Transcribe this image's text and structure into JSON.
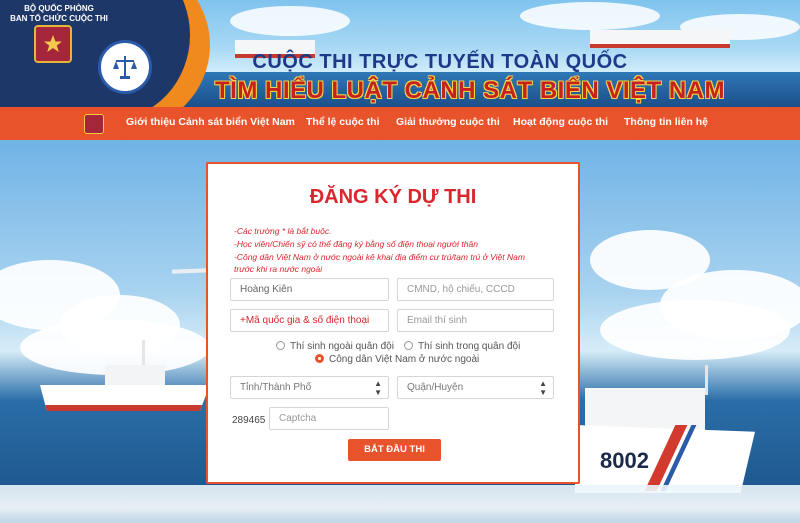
{
  "header": {
    "org_line1": "BỘ QUỐC PHÒNG",
    "org_line2": "BAN TỔ CHỨC CUỘC THI",
    "title_line1": "CUỘC THI TRỰC TUYẾN TOÀN QUỐC",
    "title_line2": "TÌM HIỂU LUẬT CẢNH SÁT BIỂN VIỆT NAM"
  },
  "nav": {
    "items": [
      {
        "label": "Giới thiệu Cảnh sát biển Việt Nam"
      },
      {
        "label": "Thể lệ cuộc thi"
      },
      {
        "label": "Giải thưởng cuộc thi"
      },
      {
        "label": "Hoạt động cuộc thi"
      },
      {
        "label": "Thông tin liên hệ"
      }
    ]
  },
  "form": {
    "title": "ĐĂNG KÝ DỰ THI",
    "notes": [
      "-Các trường * là bắt buộc.",
      "-Học viên/Chiến sỹ có thể đăng ký bằng số điện thoại người thân",
      "-Công dân Việt Nam ở nước ngoài kê khai địa điểm cư trú/tạm trú ở Việt Nam",
      "trước khi ra nước ngoài"
    ],
    "name_value": "Hoàng Kiên",
    "id_placeholder": "CMND, hộ chiếu, CCCD",
    "phone_placeholder": "+Mã quốc gia & số điện thoại",
    "email_placeholder": "Email thí sinh",
    "radios": [
      {
        "label": "Thí sinh ngoài quân đội",
        "checked": false
      },
      {
        "label": "Thí sinh trong quân đội",
        "checked": false
      },
      {
        "label": "Công dân Việt Nam ở nước ngoài",
        "checked": true
      }
    ],
    "province_selected": "Tỉnh/Thành Phố",
    "district_selected": "Quận/Huyện",
    "captcha_code": "289465",
    "captcha_placeholder": "Captcha",
    "submit_label": "BẮT ĐẦU THI"
  },
  "background": {
    "hull_number": "8002"
  },
  "colors": {
    "accent": "#e8532b",
    "title_red": "#d8272d",
    "header_navy": "#1d3768"
  }
}
